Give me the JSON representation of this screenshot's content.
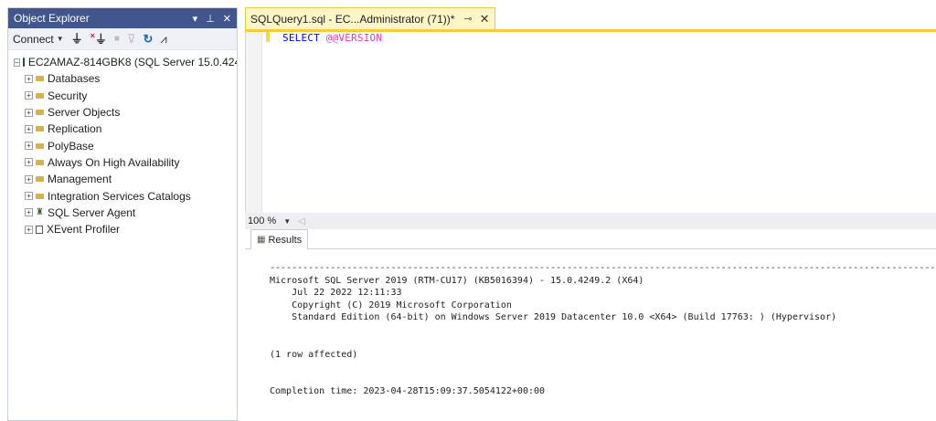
{
  "object_explorer": {
    "title": "Object Explorer",
    "title_icons": [
      "▾",
      "ꟷ",
      "✕"
    ],
    "pin_glyph": "⊥",
    "toolbar": {
      "connect_label": "Connect",
      "icons": [
        "plug-icon",
        "disconnect-icon",
        "stop-icon",
        "filter-icon",
        "refresh-icon",
        "activity-icon"
      ]
    },
    "server": "EC2AMAZ-814GBK8 (SQL Server 15.0.424",
    "nodes": [
      {
        "label": "Databases",
        "icon": "folder-icon"
      },
      {
        "label": "Security",
        "icon": "folder-icon"
      },
      {
        "label": "Server Objects",
        "icon": "folder-icon"
      },
      {
        "label": "Replication",
        "icon": "folder-icon"
      },
      {
        "label": "PolyBase",
        "icon": "folder-icon"
      },
      {
        "label": "Always On High Availability",
        "icon": "folder-icon"
      },
      {
        "label": "Management",
        "icon": "folder-icon"
      },
      {
        "label": "Integration Services Catalogs",
        "icon": "folder-icon"
      },
      {
        "label": "SQL Server Agent",
        "icon": "agent-icon"
      },
      {
        "label": "XEvent Profiler",
        "icon": "xevent-icon"
      }
    ]
  },
  "editor": {
    "tab_title": "SQLQuery1.sql - EC...Administrator (71))*",
    "tab_pin": "⊸",
    "tab_close": "✕",
    "keyword": "SELECT",
    "sysvar": "@@VERSION",
    "zoom": "100 %"
  },
  "results": {
    "tab_label": "Results",
    "separator": "----------------------------------------------------------------------------------------------------------------------------",
    "lines": [
      "Microsoft SQL Server 2019 (RTM-CU17) (KB5016394) - 15.0.4249.2 (X64)",
      "    Jul 22 2022 12:11:33",
      "    Copyright (C) 2019 Microsoft Corporation",
      "    Standard Edition (64-bit) on Windows Server 2019 Datacenter 10.0 <X64> (Build 17763: ) (Hypervisor)"
    ],
    "rows_affected": "(1 row affected)",
    "completion": "Completion time: 2023-04-28T15:09:37.5054122+00:00"
  },
  "colors": {
    "titlebar": "#40568d",
    "tab_active": "#fff6c8",
    "tab_strip": "#f5cc40",
    "keyword": "#0000ff",
    "sysvar": "#e838ae"
  }
}
